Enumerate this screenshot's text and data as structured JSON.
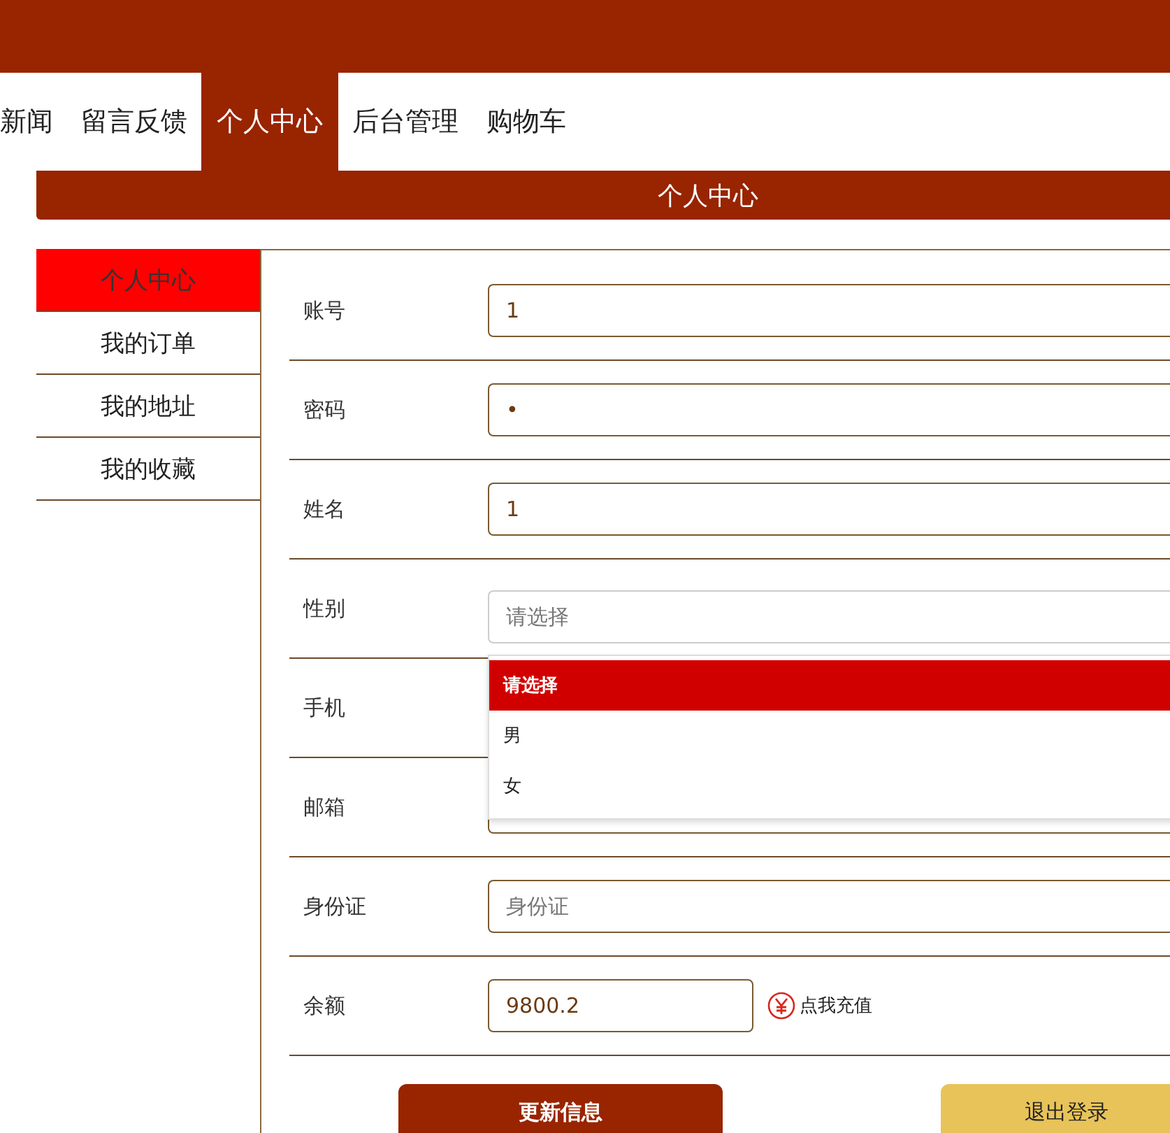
{
  "nav": [
    {
      "label": "新闻",
      "selected": false
    },
    {
      "label": "留言反馈",
      "selected": false
    },
    {
      "label": "个人中心",
      "selected": true
    },
    {
      "label": "后台管理",
      "selected": false
    },
    {
      "label": "购物车",
      "selected": false
    }
  ],
  "page_title": "个人中心",
  "sidebar": [
    {
      "label": "个人中心",
      "selected": true
    },
    {
      "label": "我的订单",
      "selected": false
    },
    {
      "label": "我的地址",
      "selected": false
    },
    {
      "label": "我的收藏",
      "selected": false
    }
  ],
  "fields": [
    {
      "kind": "text",
      "label": "账号",
      "value": "1"
    },
    {
      "kind": "text",
      "label": "密码",
      "value": "•"
    },
    {
      "kind": "text",
      "label": "姓名",
      "value": "1"
    },
    {
      "kind": "select",
      "label": "性别",
      "placeholder": "请选择",
      "expanded": true,
      "options": [
        {
          "label": "请选择",
          "selected": true
        },
        {
          "label": "男",
          "selected": false
        },
        {
          "label": "女",
          "selected": false
        }
      ]
    },
    {
      "kind": "text",
      "label": "手机"
    },
    {
      "kind": "text",
      "label": "邮箱"
    },
    {
      "kind": "text",
      "label": "身份证",
      "placeholder": "身份证"
    },
    {
      "kind": "balance",
      "label": "余额",
      "value": "9800.2",
      "link": "点我充值"
    }
  ],
  "buttons": [
    {
      "kind": "primary",
      "label": "更新信息"
    },
    {
      "kind": "secondary",
      "label": "退出登录"
    }
  ]
}
